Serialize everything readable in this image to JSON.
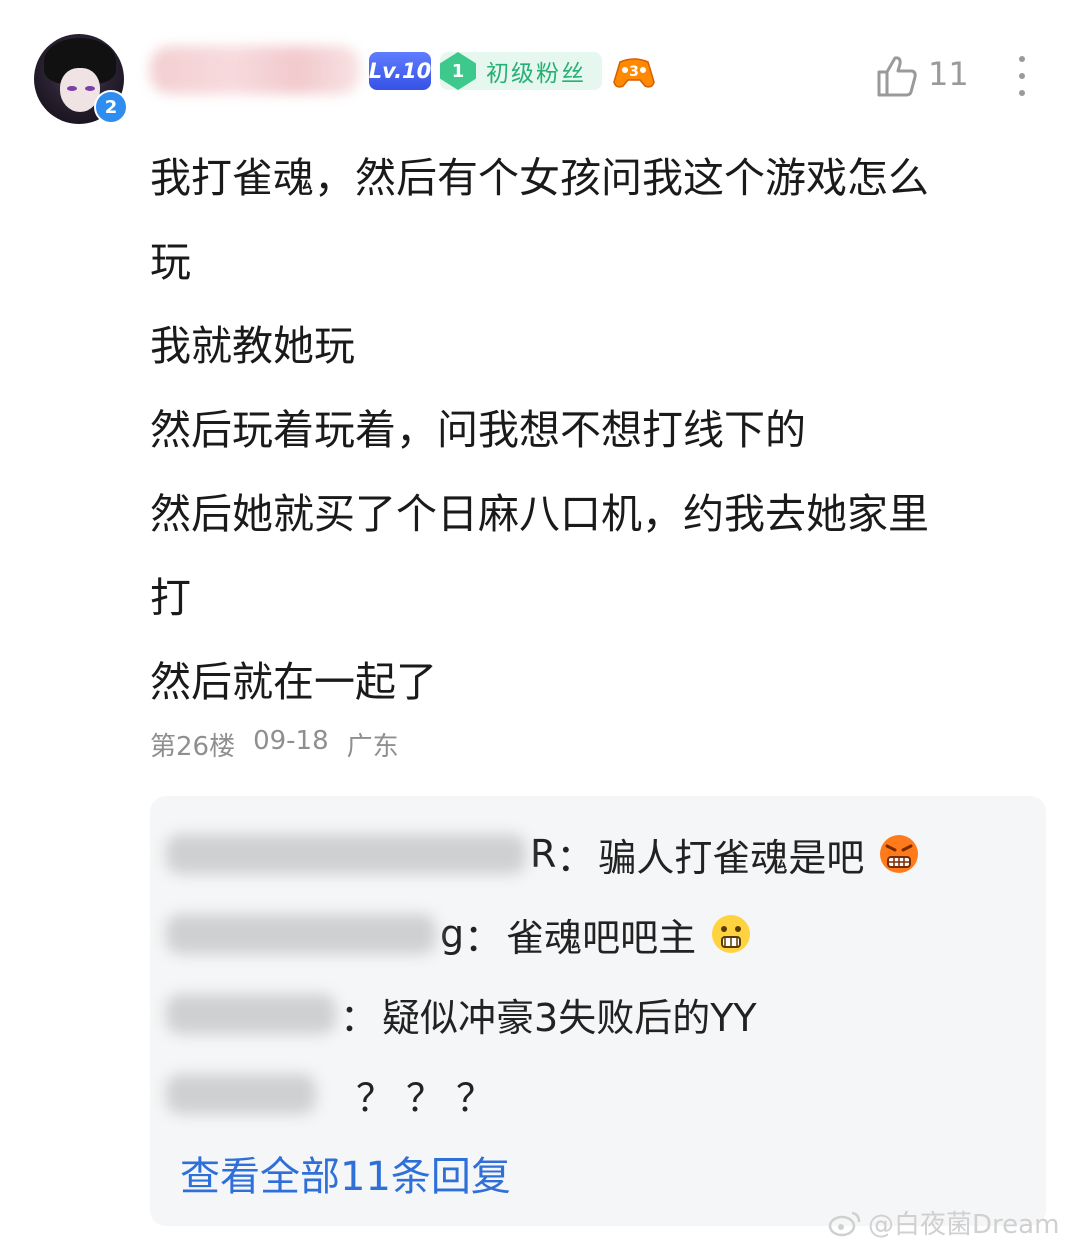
{
  "post": {
    "avatar_badge": "2",
    "level_badge": "Lv.10",
    "fan_badge": {
      "level": "1",
      "label": "初级粉丝"
    },
    "game_badge_num": "3",
    "likes": "11",
    "content_lines": [
      "我打雀魂，然后有个女孩问我这个游戏怎么",
      "玩",
      "我就教她玩",
      "然后玩着玩着，问我想不想打线下的",
      "然后她就买了个日麻八口机，约我去她家里",
      "打",
      "然后就在一起了"
    ],
    "floor": "第26楼",
    "date": "09-18",
    "location": "广东"
  },
  "replies": [
    {
      "name_suffix": "R",
      "text": "骗人打雀魂是吧",
      "emoji": "angry-emoji"
    },
    {
      "name_suffix": "g",
      "text": "雀魂吧吧主",
      "emoji": "surprised-emoji"
    },
    {
      "name_suffix": "",
      "text": "疑似冲豪3失败后的YY",
      "emoji": ""
    },
    {
      "name_suffix": "",
      "text": "？？？",
      "emoji": ""
    }
  ],
  "view_all": "查看全部11条回复",
  "watermark": "@白夜菌Dream",
  "colors": {
    "accent": "#2f6fd8",
    "fan_green": "#27b073",
    "lv_blue": "#3652e6"
  }
}
